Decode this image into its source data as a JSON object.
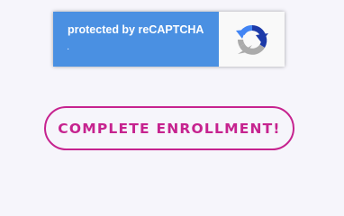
{
  "recaptcha": {
    "title": "protected by reCAPTCHA",
    "links_text": "·",
    "logo_icon": "recaptcha-logo-icon",
    "panel_color": "#4a90e2"
  },
  "enroll_button": {
    "label": "COMPLETE ENROLLMENT!",
    "color": "#c6238f"
  }
}
